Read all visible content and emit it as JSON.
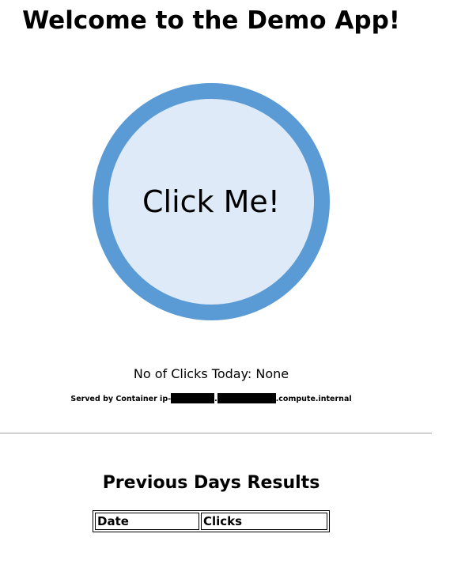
{
  "page": {
    "title": "Welcome to the Demo App!"
  },
  "click_button": {
    "label": "Click Me!"
  },
  "status": {
    "clicks_text": "No of Clicks Today: None",
    "served_prefix": "Served by Container ip-",
    "served_sep": ".",
    "served_suffix": ".compute.internal"
  },
  "previous_results": {
    "heading": "Previous Days Results",
    "columns": [
      "Date",
      "Clicks"
    ]
  },
  "colors": {
    "button_ring": "#5b9bd5",
    "button_fill": "#deeaf7",
    "divider": "#a0a0a0"
  }
}
